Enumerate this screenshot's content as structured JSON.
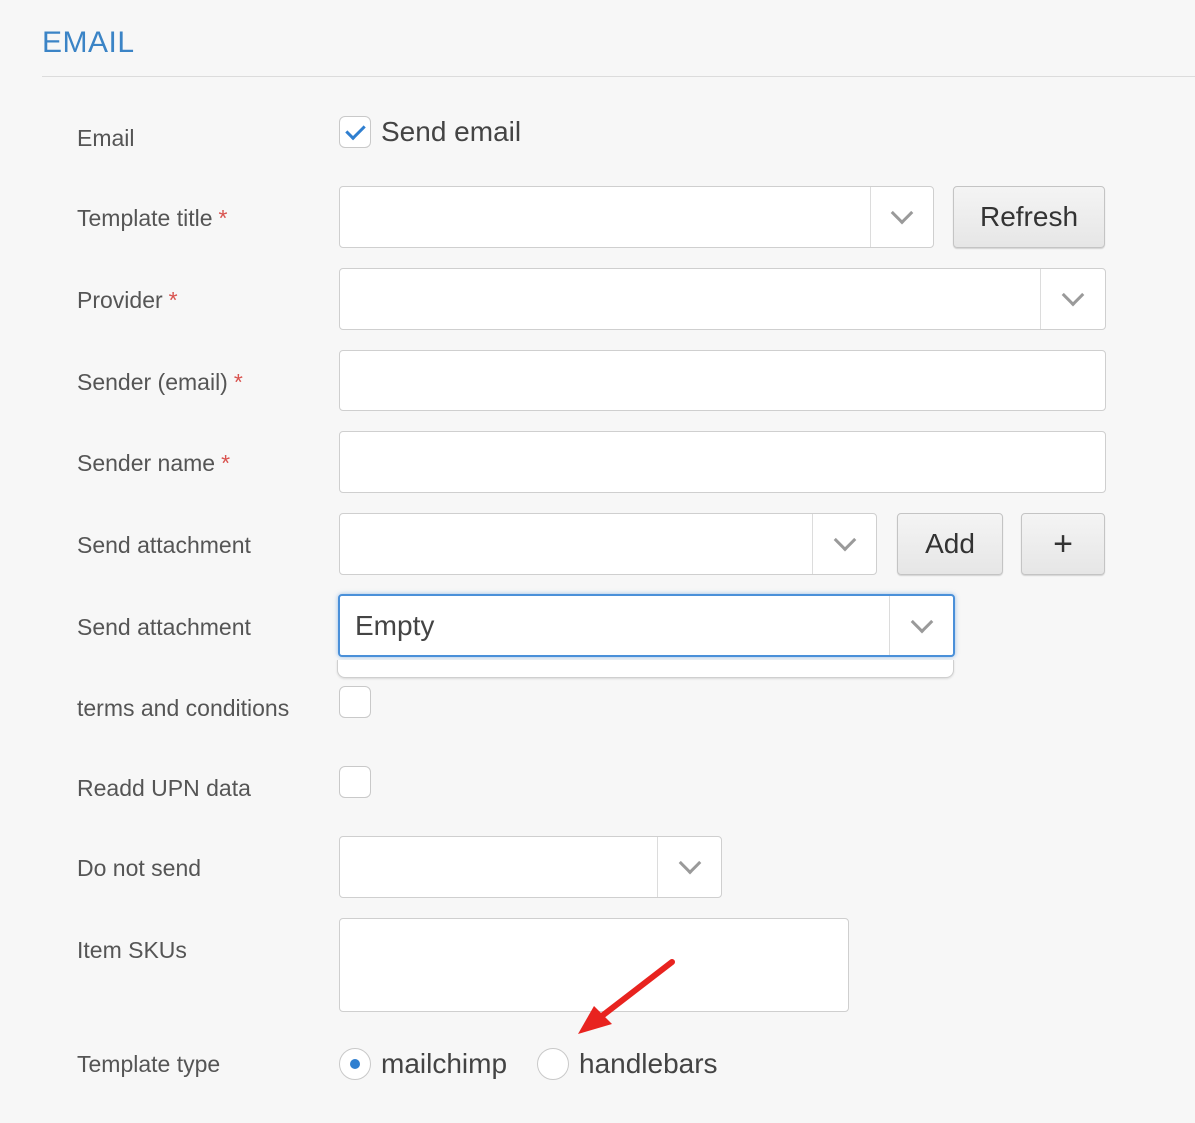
{
  "section": {
    "title": "EMAIL"
  },
  "fields": {
    "email": {
      "label": "Email",
      "checkbox_label": "Send email",
      "checked": true
    },
    "template_title": {
      "label": "Template title",
      "required_mark": "*",
      "value": "",
      "refresh_label": "Refresh"
    },
    "provider": {
      "label": "Provider",
      "required_mark": "*",
      "value": ""
    },
    "sender_email": {
      "label": "Sender (email)",
      "required_mark": "*",
      "value": ""
    },
    "sender_name": {
      "label": "Sender name",
      "required_mark": "*",
      "value": ""
    },
    "send_attachment_1": {
      "label": "Send attachment",
      "value": "",
      "add_label": "Add",
      "plus_label": "+"
    },
    "send_attachment_2": {
      "label": "Send attachment",
      "value": "Empty"
    },
    "terms": {
      "label": "terms and conditions",
      "checked": false
    },
    "readd_upn": {
      "label": "Readd UPN data",
      "checked": false
    },
    "do_not_send": {
      "label": "Do not send",
      "value": ""
    },
    "item_skus": {
      "label": "Item SKUs",
      "value": ""
    },
    "template_type": {
      "label": "Template type",
      "options": [
        {
          "label": "mailchimp",
          "selected": true
        },
        {
          "label": "handlebars",
          "selected": false
        }
      ]
    }
  },
  "colors": {
    "accent": "#3b84c6",
    "required": "#d9534f",
    "focus": "#4a90d9",
    "annotation_arrow": "#e8231f"
  },
  "icons": [
    "check-icon",
    "chevron-down-icon",
    "plus-icon",
    "arrow-annotation"
  ]
}
